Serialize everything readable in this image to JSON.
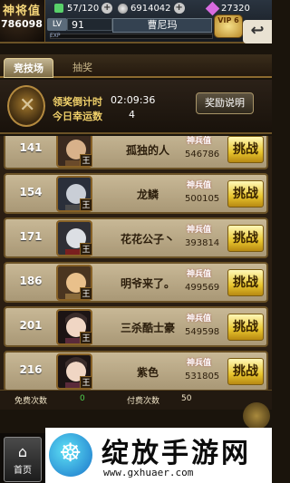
{
  "player": {
    "power_label": "神将值",
    "power_value": "786098",
    "stamina": "57/120",
    "silver": "6914042",
    "gems": "27320",
    "level_label": "LV",
    "level": "91",
    "name": "曹尼玛",
    "exp_label": "EXP",
    "vip": "VIP 6"
  },
  "tabs": [
    {
      "label": "竞技场",
      "active": true
    },
    {
      "label": "抽奖",
      "active": false
    }
  ],
  "reward_panel": {
    "countdown_label": "领奖倒计时",
    "countdown_value": "02:09:36",
    "lucky_label": "今日幸运数",
    "lucky_value": "4",
    "explain_button": "奖励说明"
  },
  "rows": [
    {
      "rank": "141",
      "name": "孤独的人",
      "score_label": "神兵值",
      "score": "546786",
      "button": "挑战",
      "badge": "王",
      "portrait_hue": "#d8b18a"
    },
    {
      "rank": "154",
      "name": "龙鳞",
      "score_label": "神兵值",
      "score": "500105",
      "button": "挑战",
      "badge": "王",
      "portrait_hue": "#c9ced6"
    },
    {
      "rank": "171",
      "name": "花花公子丶",
      "score_label": "神兵值",
      "score": "393814",
      "button": "挑战",
      "badge": "王",
      "portrait_hue": "#dcdfe4"
    },
    {
      "rank": "186",
      "name": "明爷来了。",
      "score_label": "神兵值",
      "score": "499569",
      "button": "挑战",
      "badge": "王",
      "portrait_hue": "#e9c08b"
    },
    {
      "rank": "201",
      "name": "三杀酷士豪",
      "score_label": "神兵值",
      "score": "549598",
      "button": "挑战",
      "badge": "王",
      "portrait_hue": "#3a2c2a"
    },
    {
      "rank": "216",
      "name": "紫色",
      "score_label": "神兵值",
      "score": "531805",
      "button": "挑战",
      "badge": "王",
      "portrait_hue": "#3a2c2a"
    }
  ],
  "counts": {
    "free_label": "免费次数",
    "free_value": "0",
    "paid_label": "付费次数",
    "paid_value": "50"
  },
  "nav": {
    "home_label": "首页"
  },
  "watermark": {
    "title": "绽放手游网",
    "url": "www.gxhuaer.com"
  }
}
